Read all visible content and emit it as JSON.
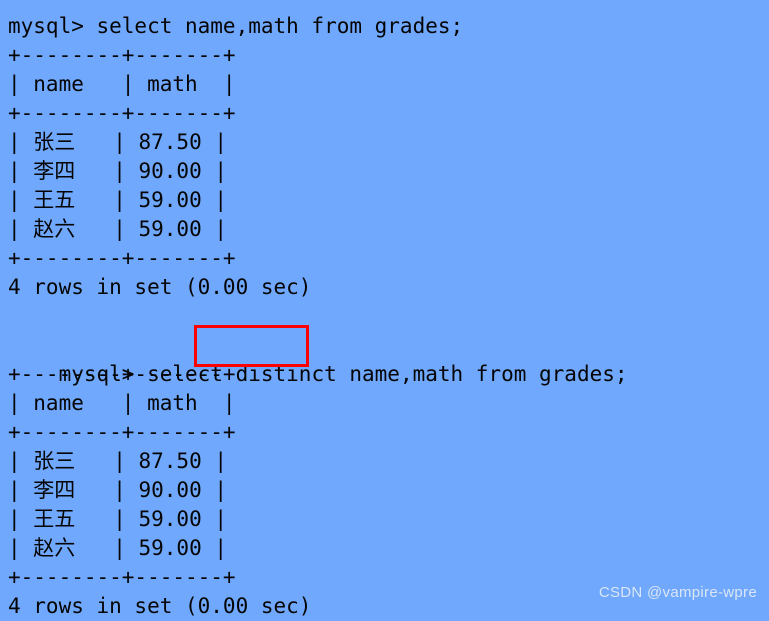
{
  "terminal": {
    "background_color": "#6fa8fc",
    "text_color": "#050505",
    "highlight_color": "#ff0000",
    "blocks": [
      {
        "prompt_line": "mysql> select name,math from grades;",
        "lines": [
          "mysql> select name,math from grades;",
          "+--------+-------+",
          "| name   | math  |",
          "+--------+-------+",
          "| 张三   | 87.50 |",
          "| 李四   | 90.00 |",
          "| 王五   | 59.00 |",
          "| 赵六   | 59.00 |",
          "+--------+-------+",
          "4 rows in set (0.00 sec)"
        ]
      },
      {
        "prompt_line": "mysql> select distinct name,math from grades;",
        "highlighted_keyword": "distinct",
        "lines": [
          "mysql> select distinct name,math from grades;",
          "+--------+-------+",
          "| name   | math  |",
          "+--------+-------+",
          "| 张三   | 87.50 |",
          "| 李四   | 90.00 |",
          "| 王五   | 59.00 |",
          "| 赵六   | 59.00 |",
          "+--------+-------+",
          "4 rows in set (0.00 sec)"
        ]
      }
    ],
    "line_01": "mysql> select name,math from grades;",
    "line_02": "+--------+-------+",
    "line_03": "| name   | math  |",
    "line_04": "+--------+-------+",
    "line_05": "| 张三   | 87.50 |",
    "line_06": "| 李四   | 90.00 |",
    "line_07": "| 王五   | 59.00 |",
    "line_08": "| 赵六   | 59.00 |",
    "line_09": "+--------+-------+",
    "line_10": "4 rows in set (0.00 sec)",
    "line_11": " ",
    "line_12": "mysql> select distinct name,math from grades;",
    "line_13": "+--------+-------+",
    "line_14": "| name   | math  |",
    "line_15": "+--------+-------+",
    "line_16": "| 张三   | 87.50 |",
    "line_17": "| 李四   | 90.00 |",
    "line_18": "| 王五   | 59.00 |",
    "line_19": "| 赵六   | 59.00 |",
    "line_20": "+--------+-------+",
    "line_21": "4 rows in set (0.00 sec)",
    "result_table": {
      "columns": [
        "name",
        "math"
      ],
      "rows": [
        [
          "张三",
          "87.50"
        ],
        [
          "李四",
          "90.00"
        ],
        [
          "王五",
          "59.00"
        ],
        [
          "赵六",
          "59.00"
        ]
      ],
      "row_count_text": "4 rows in set (0.00 sec)"
    }
  },
  "watermark": {
    "text": "CSDN @vampire-wpre"
  }
}
